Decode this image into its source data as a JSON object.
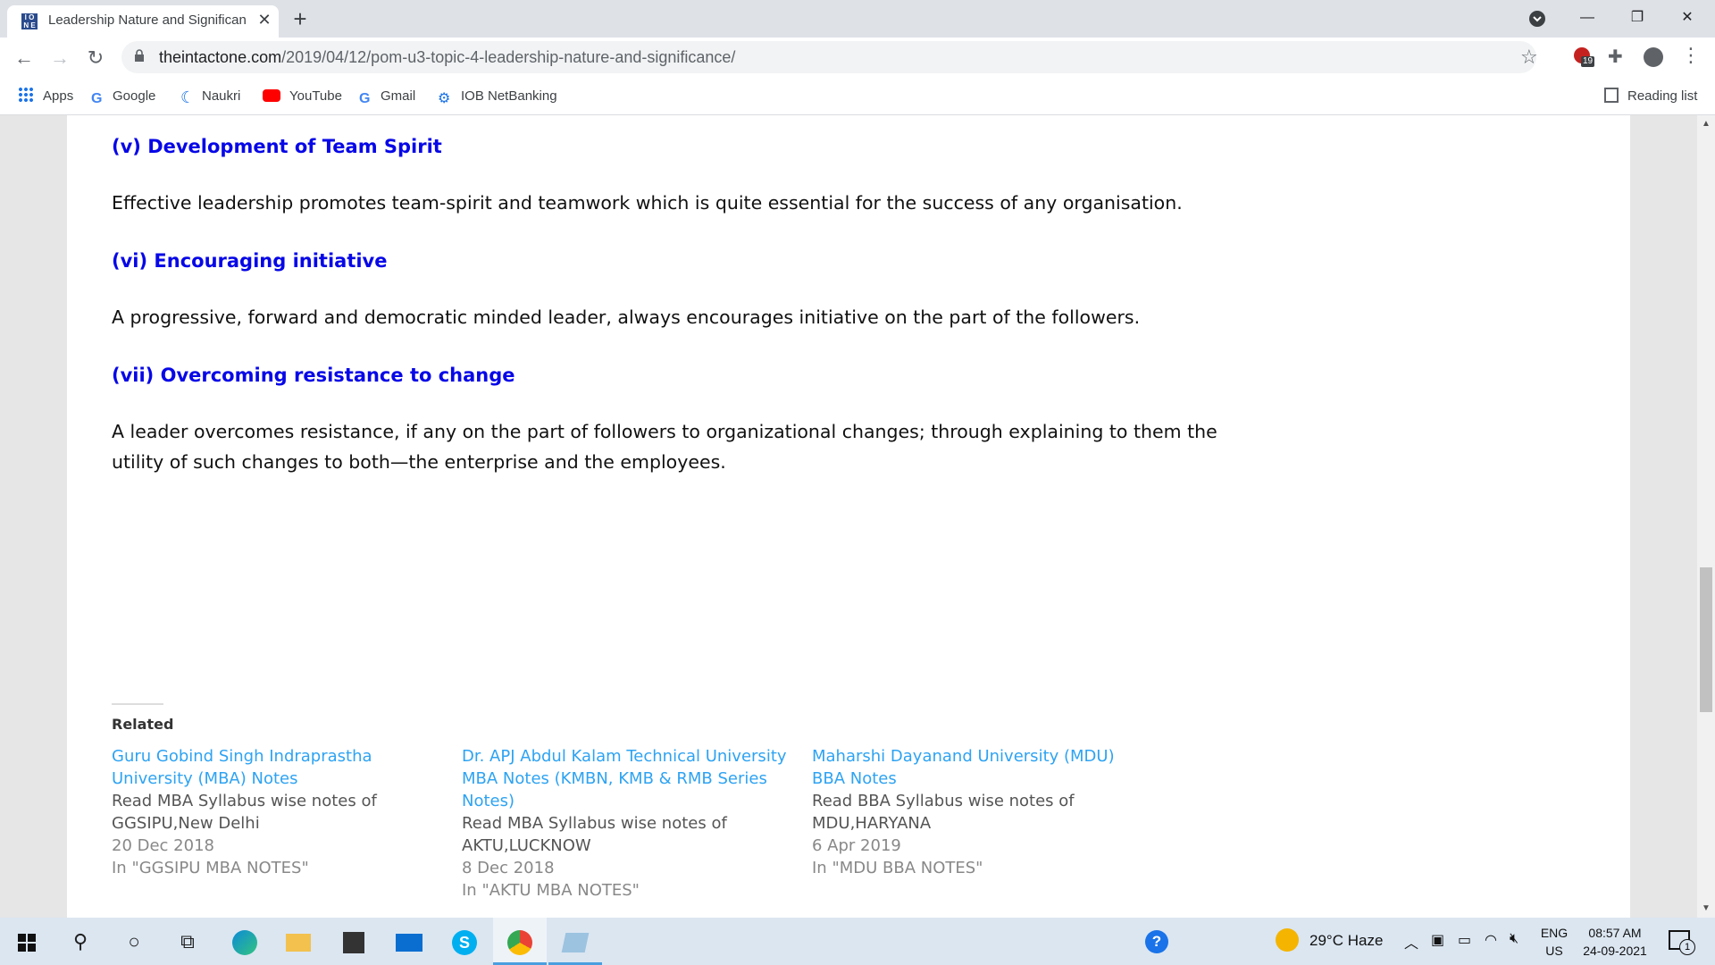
{
  "browser": {
    "tab_title": "Leadership Nature and Significan",
    "new_tab_icon": "+",
    "url_host": "theintactone.com",
    "url_path": "/2019/04/12/pom-u3-topic-4-leadership-nature-and-significance/",
    "extension_badge": "19",
    "bookmarks": [
      {
        "label": "Apps"
      },
      {
        "label": "Google"
      },
      {
        "label": "Naukri"
      },
      {
        "label": "YouTube"
      },
      {
        "label": "Gmail"
      },
      {
        "label": "IOB NetBanking"
      }
    ],
    "reading_list": "Reading list"
  },
  "article": {
    "sections": [
      {
        "heading": "(v) Development of Team Spirit",
        "text": "Effective leadership promotes team-spirit and teamwork which is quite essential for the success of any organisation."
      },
      {
        "heading": "(vi) Encouraging initiative",
        "text": "A progressive, forward and democratic minded leader, always encourages initiative on the part of the followers."
      },
      {
        "heading": "(vii) Overcoming resistance to change",
        "text": "A leader overcomes resistance, if any on the part of followers to organizational changes; through explaining to them the utility of such changes to both—the enterprise and the employees."
      }
    ]
  },
  "related": {
    "label": "Related",
    "items": [
      {
        "title": "Guru Gobind Singh Indraprastha University (MBA) Notes",
        "desc": "Read MBA Syllabus wise notes of GGSIPU,New Delhi",
        "date": "20 Dec 2018",
        "category": "In \"GGSIPU MBA NOTES\""
      },
      {
        "title": "Dr. APJ Abdul Kalam Technical University MBA Notes (KMBN, KMB & RMB Series Notes)",
        "desc": "Read MBA Syllabus wise notes of AKTU,LUCKNOW",
        "date": "8 Dec 2018",
        "category": "In \"AKTU MBA NOTES\""
      },
      {
        "title": "Maharshi Dayanand University (MDU) BBA Notes",
        "desc": "Read BBA Syllabus wise notes of MDU,HARYANA",
        "date": "6 Apr 2019",
        "category": "In \"MDU BBA NOTES\""
      }
    ]
  },
  "taskbar": {
    "weather": "29°C  Haze",
    "lang_line1": "ENG",
    "lang_line2": "US",
    "time": "08:57 AM",
    "date": "24-09-2021",
    "notification_count": "1"
  }
}
